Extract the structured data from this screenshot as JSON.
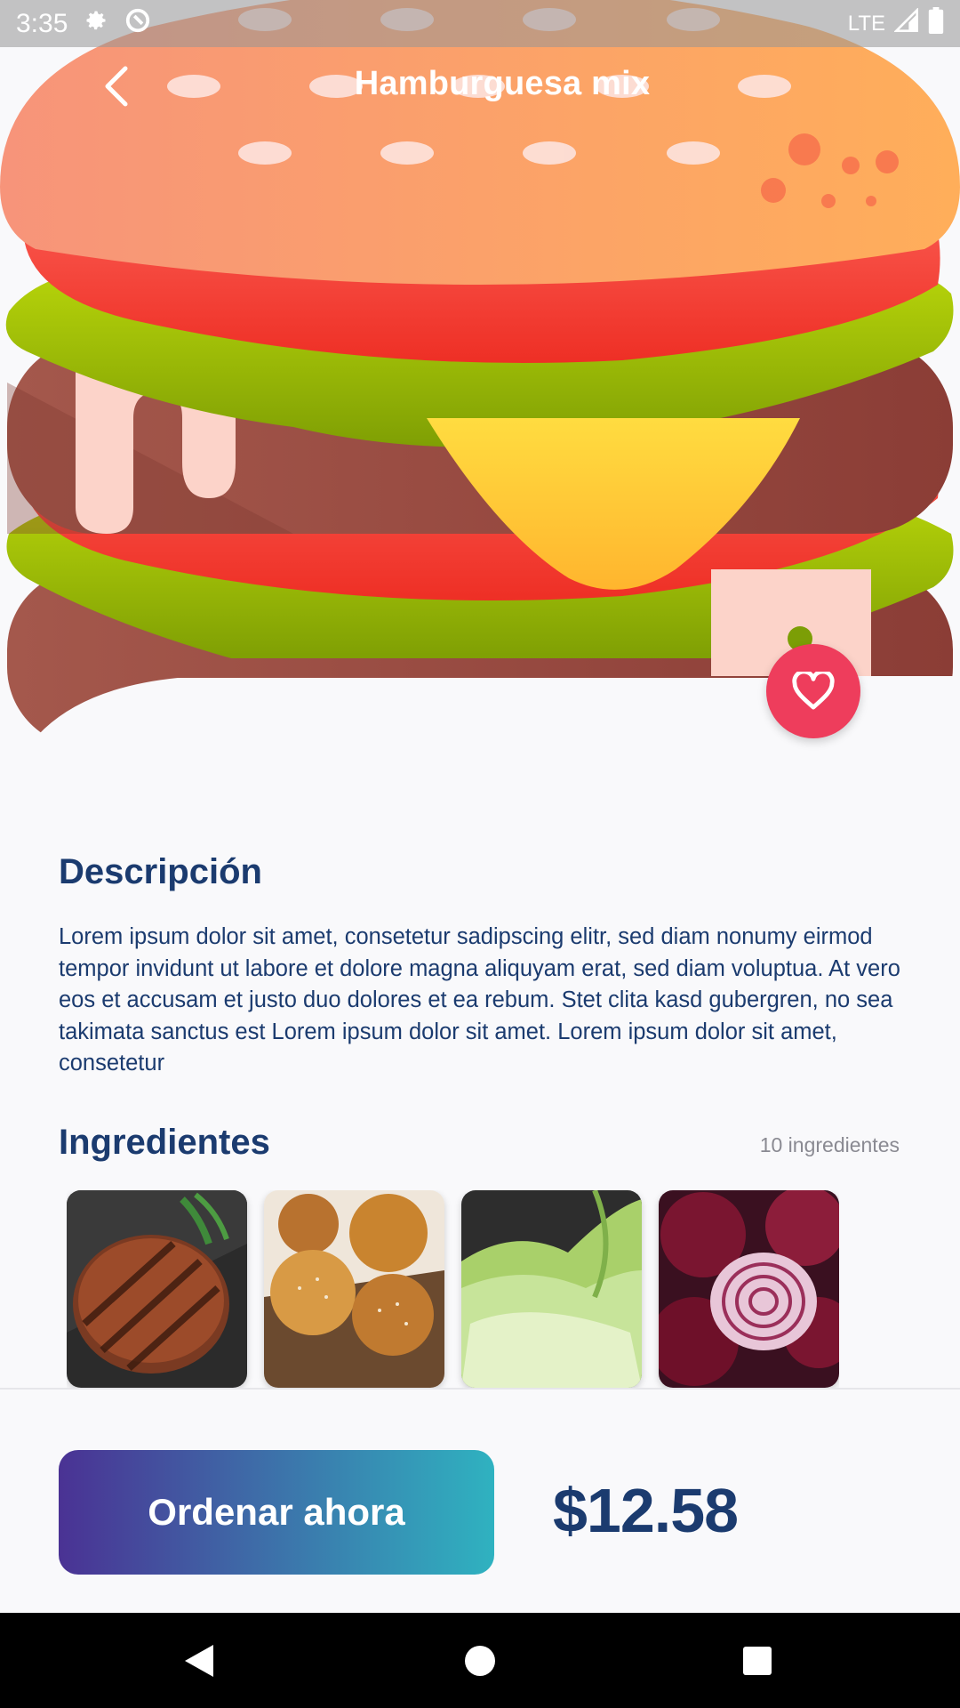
{
  "status_bar": {
    "time": "3:35",
    "network": "LTE",
    "icons": [
      "settings-icon",
      "sync-icon",
      "signal-icon",
      "battery-icon"
    ]
  },
  "app_bar": {
    "title": "Hamburguesa mix",
    "back_icon": "chevron-left-icon"
  },
  "favorite": {
    "icon": "heart-icon",
    "color": "#ee3d5c"
  },
  "description": {
    "title": "Descripción",
    "text": "Lorem ipsum dolor sit amet, consetetur sadipscing elitr, sed diam nonumy eirmod tempor invidunt ut labore et dolore magna aliquyam erat, sed diam voluptua. At vero eos et accusam et justo duo dolores et ea rebum. Stet clita kasd gubergren, no sea takimata sanctus est Lorem ipsum dolor sit amet. Lorem ipsum dolor sit amet, consetetur"
  },
  "ingredients": {
    "title": "Ingredientes",
    "count_label": "10 ingredientes",
    "items": [
      "grilled-patty-image",
      "buns-image",
      "lettuce-image",
      "red-onion-image"
    ]
  },
  "order": {
    "button_label": "Ordenar ahora",
    "price": "$12.58"
  },
  "colors": {
    "primary_text": "#1b3b6f",
    "gradient_start": "#4a3294",
    "gradient_end": "#2fb2c0"
  },
  "nav_bar": {
    "icons": [
      "back-triangle-icon",
      "home-circle-icon",
      "recents-square-icon"
    ]
  }
}
